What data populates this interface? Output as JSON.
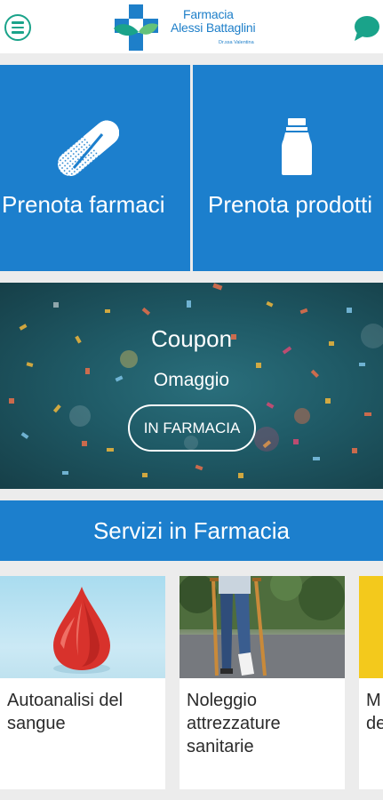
{
  "header": {
    "logo_line1": "Farmacia",
    "logo_line2": "Alessi Battaglini",
    "logo_sub": "Dr.ssa Valentina"
  },
  "tiles": [
    {
      "label": "Prenota farmaci",
      "icon": "pill-icon"
    },
    {
      "label": "Prenota prodotti",
      "icon": "bottle-icon"
    }
  ],
  "coupon": {
    "title": "Coupon",
    "subtitle": "Omaggio",
    "button": "IN FARMACIA"
  },
  "services": {
    "title": "Servizi in Farmacia",
    "cards": [
      {
        "label_lines": [
          "Autoanalisi del",
          "sangue"
        ],
        "icon": "blood-drop-icon"
      },
      {
        "label_lines": [
          "Noleggio",
          "attrezzature",
          "sanitarie"
        ],
        "icon": "crutches-photo"
      },
      {
        "label_lines": [
          "M",
          "de"
        ],
        "icon": "yellow-image"
      }
    ]
  },
  "colors": {
    "brand_blue": "#1c7fcd",
    "brand_green": "#1aa38a",
    "background": "#ececec"
  }
}
